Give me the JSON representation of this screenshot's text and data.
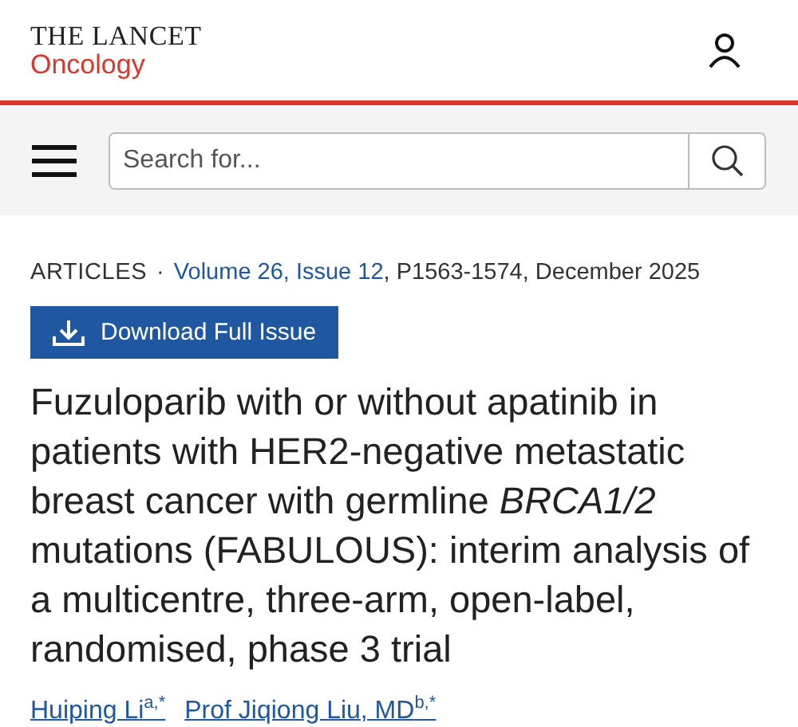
{
  "header": {
    "journal": "THE LANCET",
    "subjournal": "Oncology"
  },
  "search": {
    "placeholder": "Search for..."
  },
  "article": {
    "type": "ARTICLES",
    "separator": "·",
    "issue_link": "Volume 26, Issue 12",
    "citation": ", P1563-1574, December 2025",
    "download_button": "Download Full Issue",
    "title": "Fuzuloparib with or without apatinib in patients with HER2-negative metastatic breast cancer with germline *BRCA1/2* mutations (FABULOUS): interim analysis of a multicentre, three-arm, open-label, randomised, phase 3 trial",
    "authors": [
      {
        "name": "Huiping Li",
        "affil": "a,*"
      },
      {
        "name": "Prof Jiqiong Liu, MD",
        "affil": "b,*"
      }
    ]
  }
}
